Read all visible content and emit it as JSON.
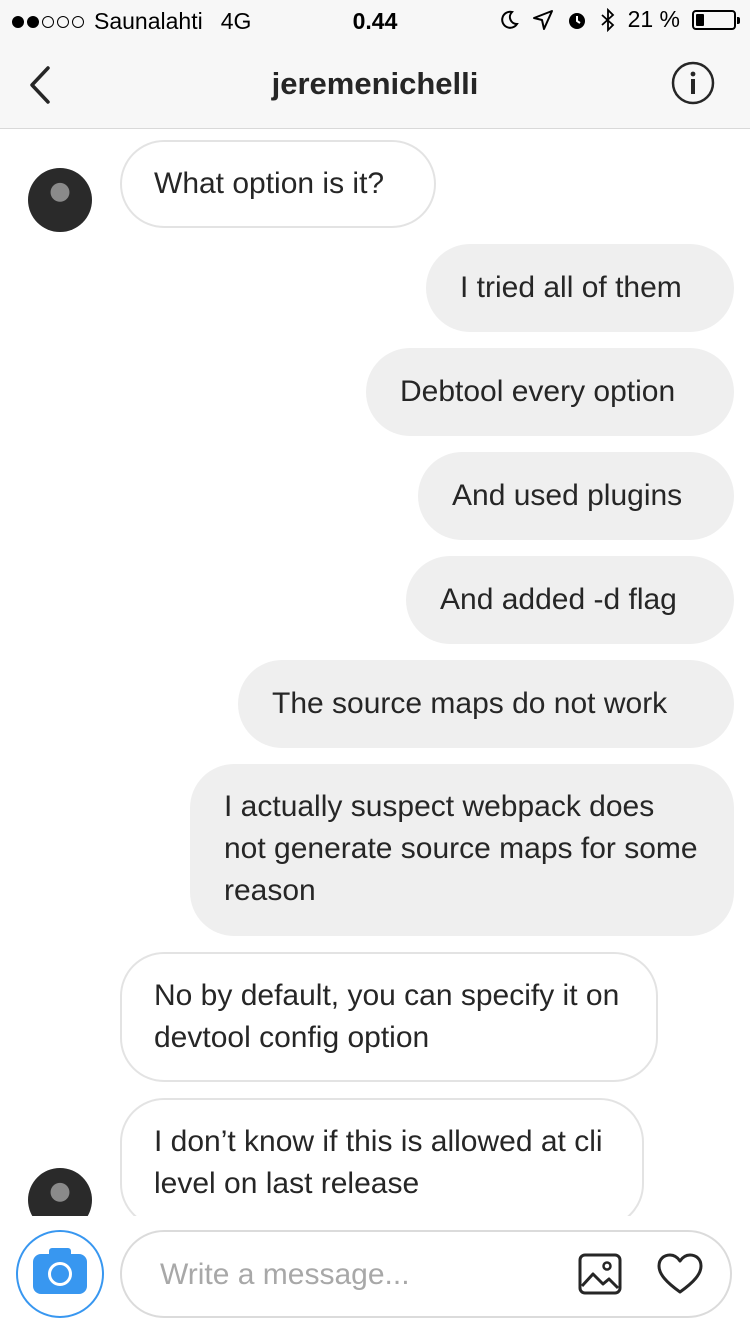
{
  "status_bar": {
    "carrier": "Saunalahti",
    "network": "4G",
    "time": "0.44",
    "battery_percent": "21 %",
    "battery_level": 0.21,
    "signal_bars": 2,
    "signal_total": 5
  },
  "nav": {
    "title": "jeremenichelli",
    "back_icon": "chevron-left-icon",
    "info_icon": "info-circle-icon"
  },
  "messages": [
    {
      "direction": "in",
      "text": "What option is it?"
    },
    {
      "direction": "out",
      "text": "I tried all of them"
    },
    {
      "direction": "out",
      "text": "Debtool every option"
    },
    {
      "direction": "out",
      "text": "And used plugins"
    },
    {
      "direction": "out",
      "text": "And added -d flag"
    },
    {
      "direction": "out",
      "text": "The source maps do not work"
    },
    {
      "direction": "out",
      "text": "I actually suspect webpack does not generate source maps for some reason"
    },
    {
      "direction": "in",
      "text": "No by default, you can specify it on devtool config option"
    },
    {
      "direction": "in",
      "text": "I don’t know if this is allowed at cli level on last release"
    }
  ],
  "composer": {
    "placeholder": "Write a message...",
    "value": ""
  },
  "colors": {
    "accent": "#3897f0",
    "outgoing_bubble": "#efefef",
    "incoming_border": "#e3e3e3"
  }
}
